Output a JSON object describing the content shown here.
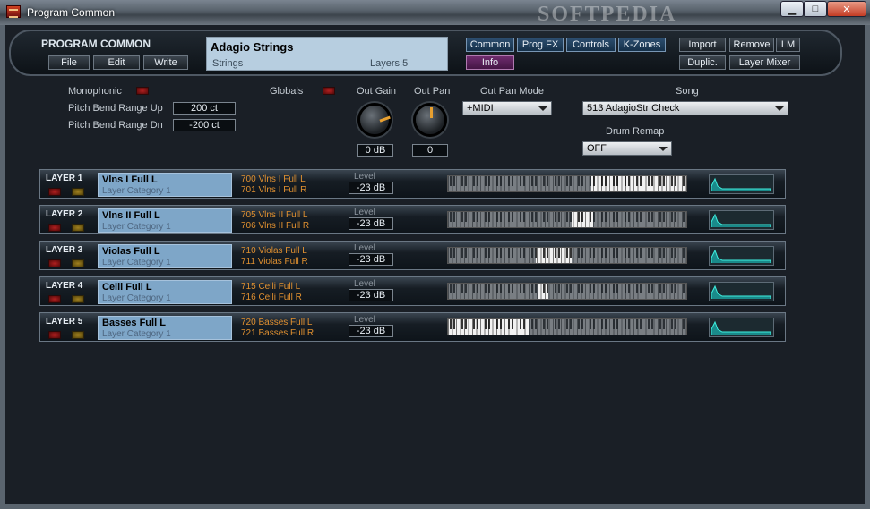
{
  "window": {
    "title": "Program Common",
    "watermark": "SOFTPEDIA"
  },
  "window_controls": {
    "minimize": "▁",
    "maximize": "□",
    "close": "✕"
  },
  "header": {
    "title": "PROGRAM COMMON",
    "file": "File",
    "edit": "Edit",
    "write": "Write",
    "program_name": "Adagio Strings",
    "program_category": "Strings",
    "layers": "Layers:5",
    "tabs": {
      "common": "Common",
      "prog_fx": "Prog FX",
      "controls": "Controls",
      "k_zones": "K-Zones",
      "info": "Info"
    },
    "import": "Import",
    "remove": "Remove",
    "lm": "LM",
    "duplic": "Duplic.",
    "layer_mixer": "Layer Mixer"
  },
  "globals": {
    "monophonic": "Monophonic",
    "globals": "Globals",
    "pb_up_label": "Pitch Bend Range Up",
    "pb_up": "200 ct",
    "pb_dn_label": "Pitch Bend Range Dn",
    "pb_dn": "-200 ct",
    "out_gain_label": "Out Gain",
    "out_gain": "0 dB",
    "out_pan_label": "Out Pan",
    "out_pan": "0",
    "out_pan_mode_label": "Out Pan Mode",
    "out_pan_mode": "+MIDI",
    "song_label": "Song",
    "song": "513 AdagioStr Check",
    "drum_remap_label": "Drum Remap",
    "drum_remap": "OFF"
  },
  "layers": [
    {
      "label": "LAYER 1",
      "program": "Vlns I Full L",
      "category": "Layer Category 1",
      "keymap1": "700 Vlns I Full L",
      "keymap2": "701 Vlns I Full R",
      "level_label": "Level",
      "level": "-23 dB",
      "range_start": 0.6,
      "range_end": 1.0
    },
    {
      "label": "LAYER 2",
      "program": "Vlns II Full L",
      "category": "Layer Category 1",
      "keymap1": "705 Vlns II Full L",
      "keymap2": "706 Vlns II Full R",
      "level_label": "Level",
      "level": "-23 dB",
      "range_start": 0.52,
      "range_end": 0.61
    },
    {
      "label": "LAYER 3",
      "program": "Violas Full L",
      "category": "Layer Category 1",
      "keymap1": "710 Violas Full L",
      "keymap2": "711 Violas Full R",
      "level_label": "Level",
      "level": "-23 dB",
      "range_start": 0.37,
      "range_end": 0.52
    },
    {
      "label": "LAYER 4",
      "program": "Celli Full L",
      "category": "Layer Category 1",
      "keymap1": "715 Celli Full L",
      "keymap2": "716 Celli Full R",
      "level_label": "Level",
      "level": "-23 dB",
      "range_start": 0.38,
      "range_end": 0.42
    },
    {
      "label": "LAYER 5",
      "program": "Basses Full L",
      "category": "Layer Category 1",
      "keymap1": "720 Basses Full L",
      "keymap2": "721 Basses Full R",
      "level_label": "Level",
      "level": "-23 dB",
      "range_start": 0.0,
      "range_end": 0.34
    }
  ]
}
